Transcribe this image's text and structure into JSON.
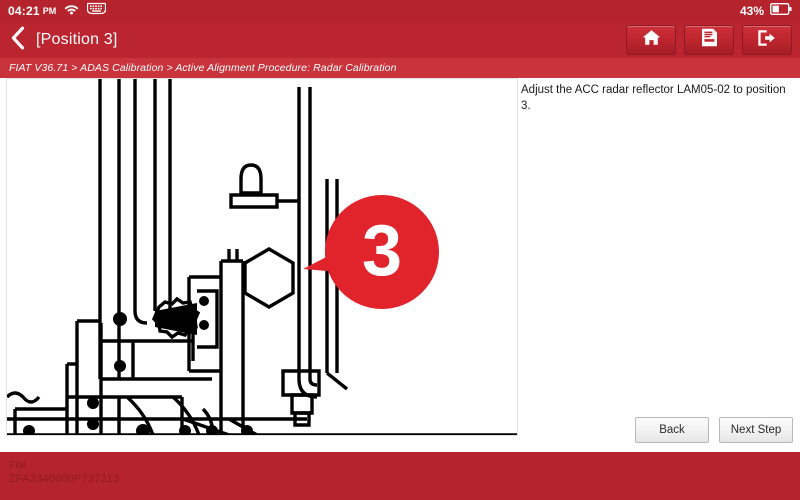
{
  "statusbar": {
    "time": "04:21",
    "ampm": "PM",
    "wifi_icon": "wifi-icon",
    "keyboard_icon": "keyboard-icon",
    "battery_percent": "43%",
    "battery_icon": "battery-icon"
  },
  "titlebar": {
    "back_icon": "chevron-left-icon",
    "title": "[Position 3]",
    "actions": [
      {
        "name": "home-button",
        "icon": "home-icon"
      },
      {
        "name": "report-button",
        "icon": "report-document-icon"
      },
      {
        "name": "exit-button",
        "icon": "exit-icon"
      }
    ]
  },
  "breadcrumb": {
    "text": "FIAT V36.71 > ADAS Calibration > Active Alignment Procedure: Radar Calibration"
  },
  "main": {
    "instruction": "Adjust the ACC radar reflector LAM05-02 to position 3.",
    "diagram": {
      "callout_number": "3",
      "callout_color": "#e1232c",
      "line_color": "#000000"
    }
  },
  "footer": {
    "back_label": "Back",
    "next_label": "Next Step"
  },
  "bottombar": {
    "make": "Fiat",
    "vin": "ZFA3340000P737213"
  },
  "colors": {
    "status_red": "#b5242c",
    "title_red": "#bb2530",
    "breadcrumb_red": "#c8333c",
    "accent_red": "#e1232c"
  }
}
